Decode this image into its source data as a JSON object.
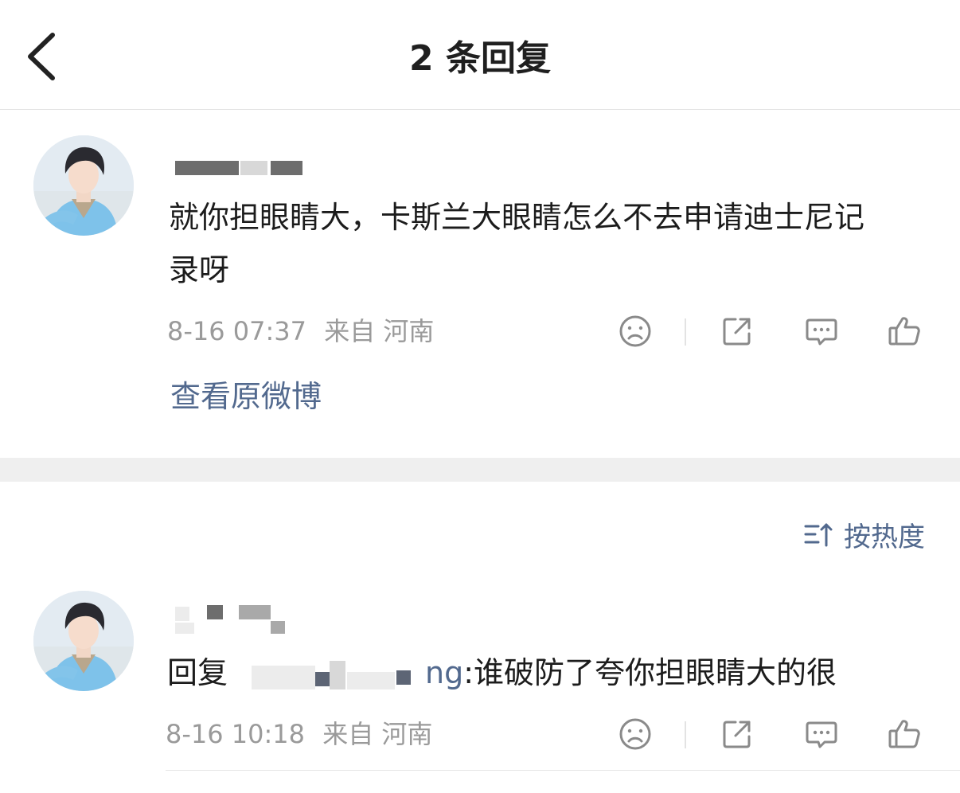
{
  "header": {
    "title": "2 条回复"
  },
  "icons": {
    "back": "chevron-left-icon",
    "dislike": "sad-face-icon",
    "share": "share-icon",
    "comment": "comment-icon",
    "like": "thumbs-up-icon",
    "sort": "sort-icon"
  },
  "colors": {
    "link": "#52698e",
    "meta": "#9a9a9a",
    "icon": "#8a8a8a",
    "section_gap": "#efefef"
  },
  "main_comment": {
    "text": "就你担眼睛大，卡斯兰大眼睛怎么不去申请迪士尼记录呀",
    "time": "8-16 07:37",
    "location": "来自 河南",
    "view_original": "查看原微博"
  },
  "sort": {
    "label": "按热度"
  },
  "reply": {
    "prefix": "回复",
    "visible_name_fragment": "ng",
    "text": ":谁破防了夸你担眼睛大的很",
    "time": "8-16 10:18",
    "location": "来自 河南"
  }
}
